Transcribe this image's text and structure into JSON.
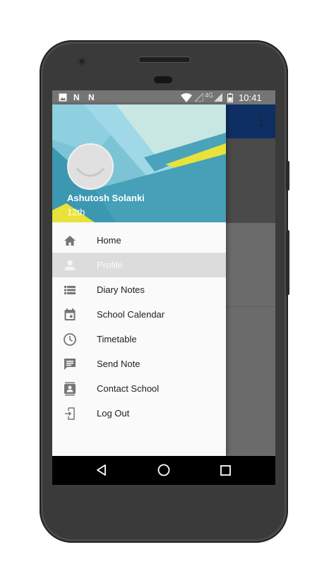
{
  "status_bar": {
    "notification_icons": [
      "gallery-icon",
      "n-icon",
      "n-icon"
    ],
    "network_label": "4G",
    "time": "10:41"
  },
  "drawer": {
    "user_name": "Ashutosh Solanki",
    "user_class": "12th",
    "items": [
      {
        "label": "Home",
        "icon": "home-icon",
        "selected": false
      },
      {
        "label": "Profile",
        "icon": "person-icon",
        "selected": true
      },
      {
        "label": "Diary Notes",
        "icon": "list-icon",
        "selected": false
      },
      {
        "label": "School Calendar",
        "icon": "calendar-icon",
        "selected": false
      },
      {
        "label": "Timetable",
        "icon": "clock-icon",
        "selected": false
      },
      {
        "label": "Send Note",
        "icon": "message-icon",
        "selected": false
      },
      {
        "label": "Contact School",
        "icon": "contact-icon",
        "selected": false
      },
      {
        "label": "Log Out",
        "icon": "logout-icon",
        "selected": false
      }
    ]
  },
  "nav_bar": {
    "buttons": [
      "back-icon",
      "home-circle-icon",
      "recents-icon"
    ]
  },
  "colors": {
    "app_bar": "#0d2f63",
    "status_bar": "#757575",
    "accent_yellow": "#e8e23a",
    "header_teal": "#7fc4d6"
  }
}
